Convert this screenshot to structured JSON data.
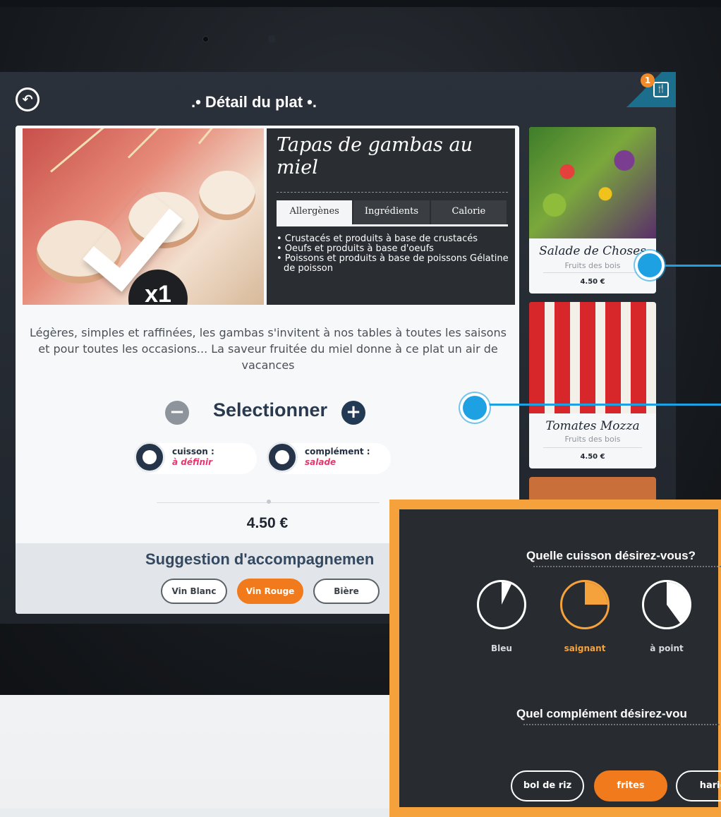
{
  "header": {
    "title": ".• Détail du plat •.",
    "cart_count": "1"
  },
  "dish": {
    "name": "Tapas de gambas au miel",
    "quantity": "x1",
    "tabs": [
      {
        "label": "Allergènes",
        "active": true
      },
      {
        "label": "Ingrédients",
        "active": false
      },
      {
        "label": "Calorie",
        "active": false
      }
    ],
    "allergens": [
      "• Crustacés et produits à base de crustacés",
      "• Oeufs et produits à base d'oeufs",
      "• Poissons et produits à base de poissons Gélatine de poisson"
    ],
    "description": "Légères, simples et raffinées, les gambas s'invitent à nos tables à toutes les saisons et pour toutes les occasions... La saveur fruitée du miel donne à ce plat un air de vacances",
    "select_label": "Selectionner",
    "options": [
      {
        "label": "cuisson :",
        "value": "à définir",
        "icon": "timer-icon"
      },
      {
        "label": "complément :",
        "value": "salade",
        "icon": "rice-bowl-icon"
      }
    ],
    "price": "4.50 €"
  },
  "suggestions": {
    "title": "Suggestion d'accompagnemen",
    "items": [
      {
        "label": "Vin Blanc",
        "active": false
      },
      {
        "label": "Vin Rouge",
        "active": true
      },
      {
        "label": "Bière",
        "active": false
      }
    ]
  },
  "side_menu": [
    {
      "name": "Salade de Choses",
      "subtitle": "Fruits des bois",
      "price": "4.50 €"
    },
    {
      "name": "Tomates Mozza",
      "subtitle": "Fruits des bois",
      "price": "4.50 €"
    }
  ],
  "popup": {
    "cooking_question": "Quelle cuisson désirez-vous?",
    "doneness": [
      {
        "label": "Bleu",
        "fill": 0.1,
        "active": false
      },
      {
        "label": "saignant",
        "fill": 0.25,
        "active": true
      },
      {
        "label": "à point",
        "fill": 0.4,
        "active": false
      }
    ],
    "side_question": "Quel complément désirez-vou",
    "sides": [
      {
        "label": "bol de riz",
        "active": false
      },
      {
        "label": "frites",
        "active": true
      },
      {
        "label": "haric",
        "active": false
      }
    ],
    "accent_color": "#f07a1c"
  }
}
